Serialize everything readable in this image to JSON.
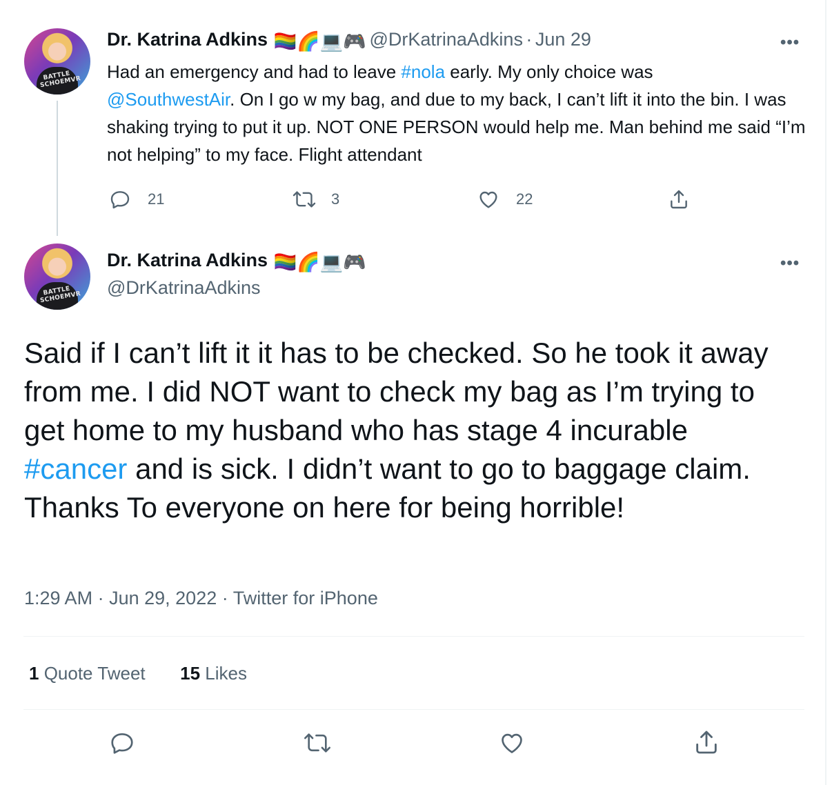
{
  "colors": {
    "link": "#1d9bf0",
    "muted": "#536471",
    "text": "#0f1419",
    "divider": "#eff3f4"
  },
  "parent_tweet": {
    "author_name": "Dr. Katrina Adkins",
    "author_emojis": "🏳️‍🌈🌈💻🎮",
    "handle": "@DrKatrinaAdkins",
    "separator": "·",
    "date": "Jun 29",
    "more": "•••",
    "text_1": "Had an emergency and had to leave ",
    "hashtag": "#nola",
    "text_2": " early. My only choice was",
    "mention": "@SouthwestAir",
    "text_3": ". On I go w my bag, and due to my back, I can’t lift it into the bin. I was shaking trying to put it up. NOT ONE PERSON would help me. Man behind me said “I’m not helping” to my face. Flight attendant",
    "replies": "21",
    "retweets": "3",
    "likes": "22",
    "avatar_text": "BATTLE SCHOEMVR"
  },
  "main_tweet": {
    "author_name": "Dr. Katrina Adkins",
    "author_emojis": "🏳️‍🌈🌈💻🎮",
    "handle": "@DrKatrinaAdkins",
    "more": "•••",
    "text_1": "Said if I can’t lift it it has to be checked. So he took it away from me. I did NOT want to check my bag as I’m trying to get home to my husband who has stage 4 incurable ",
    "hashtag": "#cancer",
    "text_2": " and is sick. I didn’t want to go to baggage claim. Thanks To everyone on here for being horrible!",
    "time": "1:29 AM",
    "separator": "·",
    "date": "Jun 29, 2022",
    "source": "Twitter for iPhone",
    "quote_count": "1",
    "quote_label": " Quote Tweet",
    "like_count": "15",
    "like_label": " Likes",
    "avatar_text": "BATTLE SCHOEMVR"
  }
}
